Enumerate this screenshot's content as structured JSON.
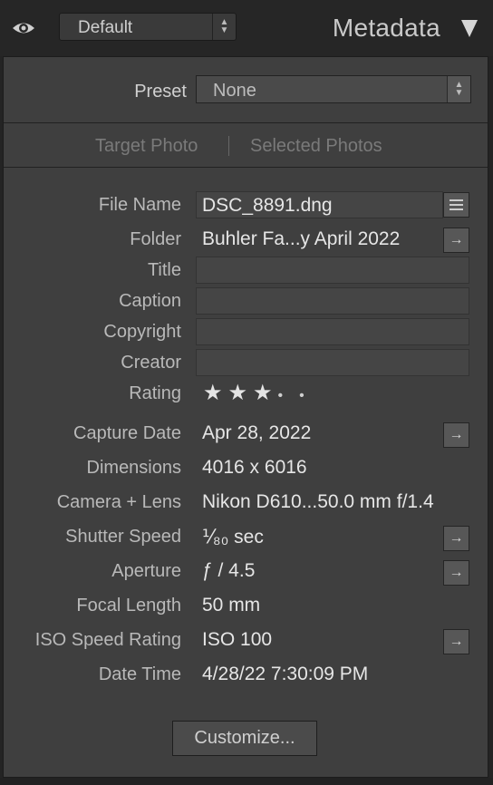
{
  "header": {
    "preset_value": "Default",
    "panel_title": "Metadata",
    "visibility_icon": "eye-icon",
    "collapse_icon": "triangle-down-icon"
  },
  "preset": {
    "label": "Preset",
    "value": "None"
  },
  "target": {
    "target_photo": "Target Photo",
    "selected_photos": "Selected Photos"
  },
  "fields": {
    "file_name": {
      "label": "File Name",
      "value": "DSC_8891.dng"
    },
    "folder": {
      "label": "Folder",
      "value": "Buhler Fa...y April 2022"
    },
    "title": {
      "label": "Title",
      "value": ""
    },
    "caption": {
      "label": "Caption",
      "value": ""
    },
    "copyright": {
      "label": "Copyright",
      "value": ""
    },
    "creator": {
      "label": "Creator",
      "value": ""
    },
    "rating": {
      "label": "Rating",
      "stars_filled": 3,
      "stars_total": 5
    },
    "capture_date": {
      "label": "Capture Date",
      "value": "Apr 28, 2022"
    },
    "dimensions": {
      "label": "Dimensions",
      "value": "4016 x 6016"
    },
    "camera_lens": {
      "label": "Camera + Lens",
      "value": "Nikon D610...50.0 mm f/1.4"
    },
    "shutter_speed": {
      "label": "Shutter Speed",
      "value": "⅟₈₀ sec"
    },
    "aperture": {
      "label": "Aperture",
      "value": "ƒ / 4.5"
    },
    "focal_length": {
      "label": "Focal Length",
      "value": "50 mm"
    },
    "iso": {
      "label": "ISO Speed Rating",
      "value": "ISO 100"
    },
    "date_time": {
      "label": "Date Time",
      "value": "4/28/22 7:30:09 PM"
    }
  },
  "customize_label": "Customize...",
  "colors": {
    "panel": "#3f3f3f",
    "text": "#e6e6e6",
    "label": "#b9b9b9"
  }
}
